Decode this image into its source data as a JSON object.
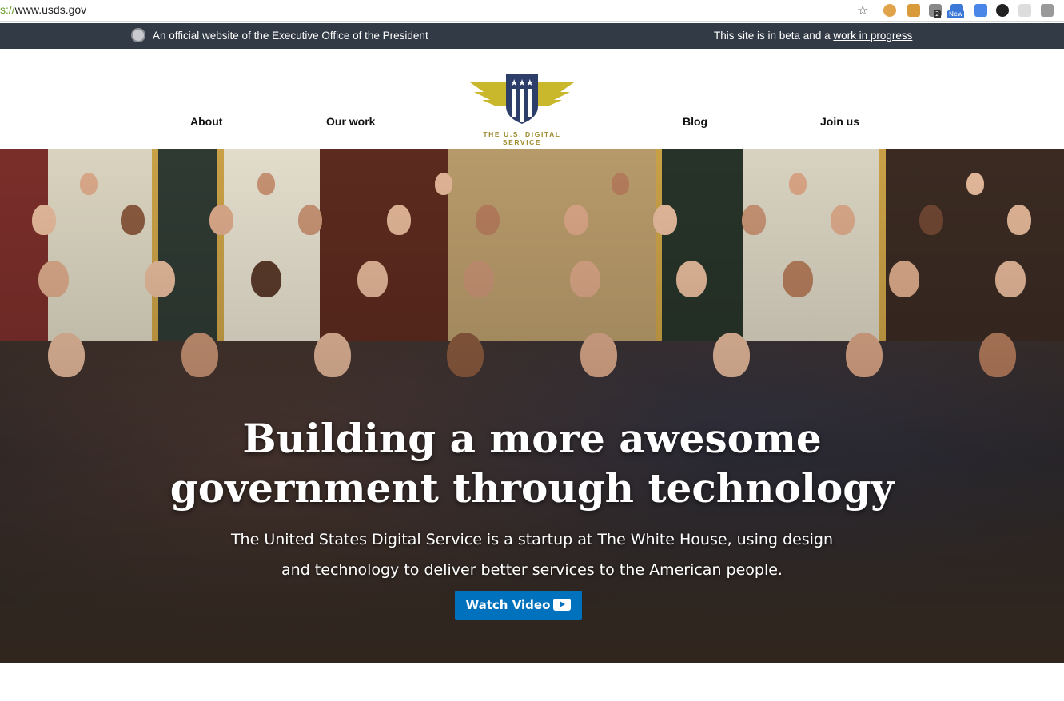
{
  "browser": {
    "url_scheme": "s://",
    "url_host": "www.usds.gov",
    "bookmark_icon": "star-icon",
    "extensions": [
      {
        "name": "cookie-extension-icon",
        "color": "#e1a34a"
      },
      {
        "name": "ruler-extension-icon",
        "color": "#d99a3c"
      },
      {
        "name": "lock-extension-icon",
        "color": "#888888",
        "badge": "2"
      },
      {
        "name": "s-extension-icon",
        "color": "#3b78d8",
        "badge": "New"
      },
      {
        "name": "window-extension-icon",
        "color": "#4a86e8"
      },
      {
        "name": "github-icon",
        "color": "#222222"
      },
      {
        "name": "flower-extension-icon",
        "color": "#bbbbbb"
      },
      {
        "name": "gray-extension-icon",
        "color": "#999999"
      }
    ]
  },
  "gov_banner": {
    "official_text": "An official website of the Executive Office of the President",
    "beta_prefix": "This site is in beta and a ",
    "beta_link": "work in progress"
  },
  "nav": {
    "items": [
      "About",
      "Our work",
      "Blog",
      "Join us"
    ],
    "logo_text": "THE U.S. DIGITAL SERVICE"
  },
  "hero": {
    "title_line1": "Building a more awesome",
    "title_line2": "government through technology",
    "subtitle_line1": "The United States Digital Service is a startup at The White House, using design",
    "subtitle_line2": "and technology to deliver better services to the American people.",
    "button_label": "Watch Video",
    "button_icon": "youtube-play-icon"
  },
  "colors": {
    "banner_bg": "#323a45",
    "button_bg": "#0071bc",
    "logo_gold": "#c9b82b",
    "logo_navy": "#2e3e6b"
  }
}
